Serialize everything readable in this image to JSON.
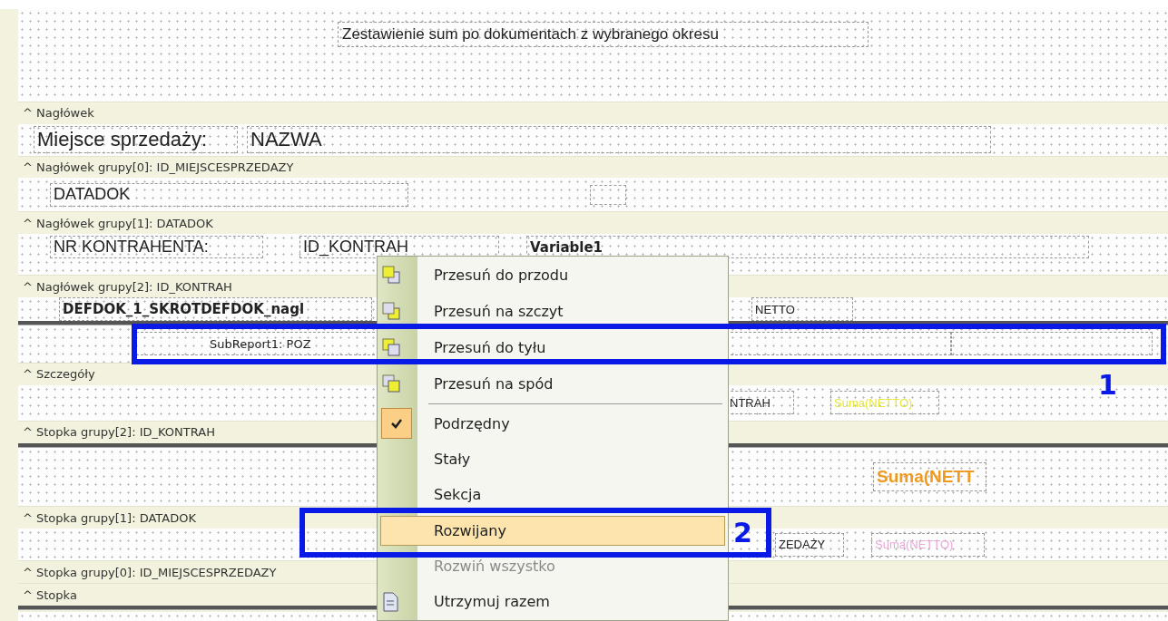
{
  "report_title": "Zestawienie sum po dokumentach z wybranego okresu",
  "bands": [
    {
      "label": "^ Nagłówek",
      "rows": [
        {
          "divider": false,
          "fields": [
            {
              "kind": "large",
              "text": "Miejsce sprzedaży:"
            },
            {
              "kind": "large",
              "text": "NAZWA"
            }
          ]
        }
      ]
    },
    {
      "label": "^ Nagłówek grupy[0]: ID_MIEJSCESPRZEDAZY",
      "rows": [
        {
          "divider": false,
          "fields": [
            {
              "kind": "medium",
              "text": "DATADOK"
            },
            {
              "kind": "empty"
            }
          ]
        }
      ]
    },
    {
      "label": "^ Nagłówek grupy[1]: DATADOK",
      "rows": [
        {
          "divider": false,
          "fields": [
            {
              "kind": "medium",
              "text": "NR KONTRAHENTA:"
            },
            {
              "kind": "medium",
              "text": "ID_KONTRAH"
            },
            {
              "kind": "bold",
              "text": "Variable1"
            }
          ]
        }
      ]
    },
    {
      "label": "^ Nagłówek grupy[2]: ID_KONTRAH",
      "rows": [
        {
          "divider": false,
          "fields": [
            {
              "kind": "bold",
              "text": "DEFDOK_1_SKROTDEFDOK_nagl"
            },
            {
              "kind": "small",
              "text": "NETTO"
            }
          ]
        },
        {
          "divider": true,
          "fields": [
            {
              "kind": "subreport",
              "text": "SubReport1: POZ"
            },
            {
              "kind": "empty"
            }
          ]
        }
      ]
    },
    {
      "label": "^ Szczegóły",
      "rows": [
        {
          "divider": false,
          "fields": [
            {
              "kind": "small",
              "text": "NTRAH"
            },
            {
              "kind": "small",
              "text": "Suma(NETTO)",
              "color": "#e6e63c"
            }
          ]
        }
      ]
    },
    {
      "label": "^ Stopka grupy[2]: ID_KONTRAH",
      "rows": [
        {
          "divider": true,
          "fields": [
            {
              "kind": "sum",
              "text": "Suma(NETT",
              "color": "#ee9a1e"
            }
          ]
        }
      ]
    },
    {
      "label": "^ Stopka grupy[1]: DATADOK",
      "rows": [
        {
          "divider": false,
          "fields": [
            {
              "kind": "small",
              "text": "ZEDAŻY"
            },
            {
              "kind": "small",
              "text": "Suma(NETTO)",
              "color": "#e9a6d6"
            }
          ]
        }
      ]
    },
    {
      "label": "^ Stopka grupy[0]: ID_MIEJSCESPRZEDAZY"
    },
    {
      "label": "^ Stopka",
      "rows": [
        {
          "divider": true,
          "fields": []
        }
      ]
    }
  ],
  "context_menu": {
    "items": [
      {
        "kind": "command",
        "label": "Przesuń do przodu",
        "disabled": false,
        "selected": false
      },
      {
        "kind": "command",
        "label": "Przesuń na szczyt",
        "disabled": false,
        "selected": false
      },
      {
        "kind": "command",
        "label": "Przesuń do tyłu",
        "disabled": false,
        "selected": false
      },
      {
        "kind": "command",
        "label": "Przesuń na spód",
        "disabled": false,
        "selected": false
      },
      {
        "kind": "separator"
      },
      {
        "kind": "toggle",
        "label": "Podrzędny",
        "checked": true,
        "disabled": false,
        "selected": false
      },
      {
        "kind": "toggle",
        "label": "Stały",
        "checked": false,
        "disabled": false,
        "selected": false
      },
      {
        "kind": "toggle",
        "label": "Sekcja",
        "checked": false,
        "disabled": false,
        "selected": false
      },
      {
        "kind": "toggle",
        "label": "Rozwijany",
        "checked": false,
        "disabled": false,
        "selected": true
      },
      {
        "kind": "command",
        "label": "Rozwiń wszystko",
        "disabled": true,
        "selected": false
      },
      {
        "kind": "command",
        "label": "Utrzymuj razem",
        "disabled": false,
        "selected": false
      }
    ]
  },
  "annotations": [
    {
      "number": "1"
    },
    {
      "number": "2"
    }
  ]
}
